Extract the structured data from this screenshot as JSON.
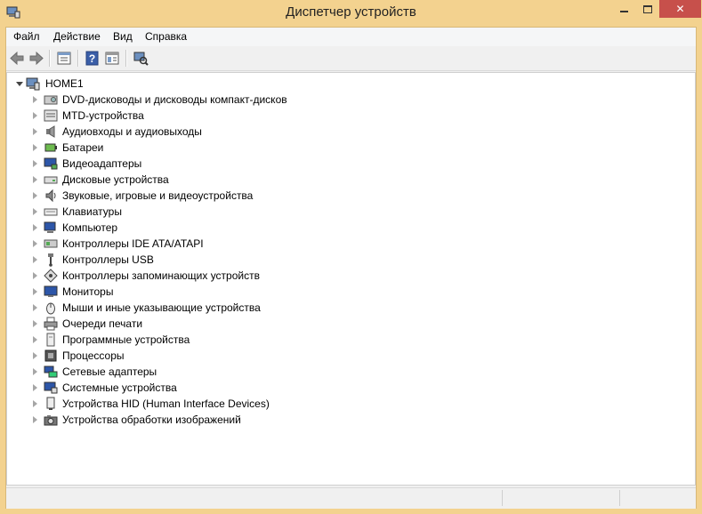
{
  "window": {
    "title": "Диспетчер устройств"
  },
  "menu": {
    "items": [
      {
        "label": "Файл",
        "name": "menu-file"
      },
      {
        "label": "Действие",
        "name": "menu-action"
      },
      {
        "label": "Вид",
        "name": "menu-view"
      },
      {
        "label": "Справка",
        "name": "menu-help"
      }
    ]
  },
  "toolbar": {
    "buttons": [
      "back-arrow-icon",
      "forward-arrow-icon",
      "properties-icon",
      "help-icon",
      "view-details-icon",
      "scan-hardware-icon"
    ]
  },
  "tree": {
    "root": {
      "label": "HOME1",
      "icon": "computer-icon",
      "expanded": true
    },
    "categories": [
      {
        "label": "DVD-дисководы и дисководы компакт-дисков",
        "icon": "dvd-drive-icon"
      },
      {
        "label": "MTD-устройства",
        "icon": "mtd-device-icon"
      },
      {
        "label": "Аудиовходы и аудиовыходы",
        "icon": "speaker-icon"
      },
      {
        "label": "Батареи",
        "icon": "battery-icon"
      },
      {
        "label": "Видеоадаптеры",
        "icon": "display-adapter-icon"
      },
      {
        "label": "Дисковые устройства",
        "icon": "disk-drive-icon"
      },
      {
        "label": "Звуковые, игровые и видеоустройства",
        "icon": "sound-icon"
      },
      {
        "label": "Клавиатуры",
        "icon": "keyboard-icon"
      },
      {
        "label": "Компьютер",
        "icon": "computer-icon"
      },
      {
        "label": "Контроллеры IDE ATA/ATAPI",
        "icon": "ide-controller-icon"
      },
      {
        "label": "Контроллеры USB",
        "icon": "usb-icon"
      },
      {
        "label": "Контроллеры запоминающих устройств",
        "icon": "storage-controller-icon"
      },
      {
        "label": "Мониторы",
        "icon": "monitor-icon"
      },
      {
        "label": "Мыши и иные указывающие устройства",
        "icon": "mouse-icon"
      },
      {
        "label": "Очереди печати",
        "icon": "printer-icon"
      },
      {
        "label": "Программные устройства",
        "icon": "software-device-icon"
      },
      {
        "label": "Процессоры",
        "icon": "processor-icon"
      },
      {
        "label": "Сетевые адаптеры",
        "icon": "network-adapter-icon"
      },
      {
        "label": "Системные устройства",
        "icon": "system-device-icon"
      },
      {
        "label": "Устройства HID (Human Interface Devices)",
        "icon": "hid-icon"
      },
      {
        "label": "Устройства обработки изображений",
        "icon": "camera-icon"
      }
    ]
  },
  "colors": {
    "frame": "#f3d28f",
    "close": "#c7504b",
    "pane": "#ffffff"
  }
}
